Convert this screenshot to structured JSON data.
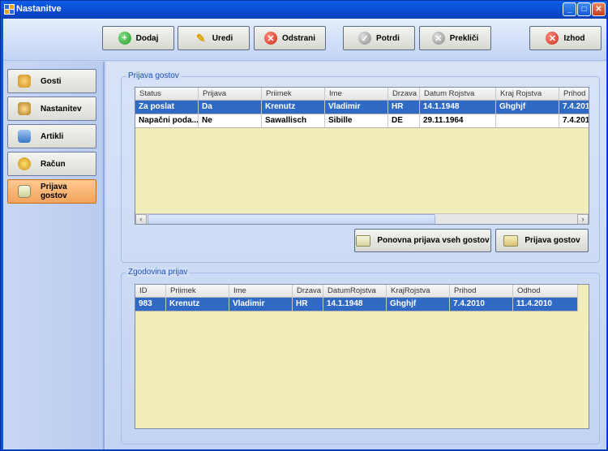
{
  "window": {
    "title": "Nastanitve"
  },
  "toolbar": {
    "add_label": "Dodaj",
    "edit_label": "Uredi",
    "remove_label": "Odstrani",
    "confirm_label": "Potrdi",
    "cancel_label": "Prekliči",
    "exit_label": "Izhod"
  },
  "sidebar": {
    "items": [
      {
        "label": "Gosti",
        "icon": "guests-icon"
      },
      {
        "label": "Nastanitev",
        "icon": "accommodation-icon"
      },
      {
        "label": "Artikli",
        "icon": "articles-icon"
      },
      {
        "label": "Račun",
        "icon": "invoice-icon"
      },
      {
        "label": "Prijava gostov",
        "icon": "guest-registration-icon",
        "active": true
      }
    ]
  },
  "registration": {
    "group_label": "Prijava gostov",
    "columns": [
      "Status",
      "Prijava",
      "Priimek",
      "Ime",
      "Drzava",
      "Datum Rojstva",
      "Kraj Rojstva",
      "Prihod"
    ],
    "rows": [
      [
        "Za poslat",
        "Da",
        "Krenutz",
        "Vladimir",
        "HR",
        "14.1.1948",
        "Ghghjf",
        "7.4.201"
      ],
      [
        "Napačni poda...",
        "Ne",
        "Sawallisch",
        "Sibille",
        "DE",
        "29.11.1964",
        "",
        "7.4.201"
      ]
    ],
    "reregister_all_label": "Ponovna prijava vseh gostov",
    "register_label": "Prijava gostov"
  },
  "history": {
    "group_label": "Zgodovina prijav",
    "columns": [
      "ID",
      "Priimek",
      "Ime",
      "Drzava",
      "DatumRojstva",
      "KrajRojstva",
      "Prihod",
      "Odhod"
    ],
    "rows": [
      [
        "983",
        "Krenutz",
        "Vladimir",
        "HR",
        "14.1.1948",
        "Ghghjf",
        "7.4.2010",
        "11.4.2010"
      ]
    ]
  },
  "colors": {
    "selection": "#316ac5",
    "grid_background": "#f1eebb",
    "active_sidebar": "#f5a45a"
  }
}
